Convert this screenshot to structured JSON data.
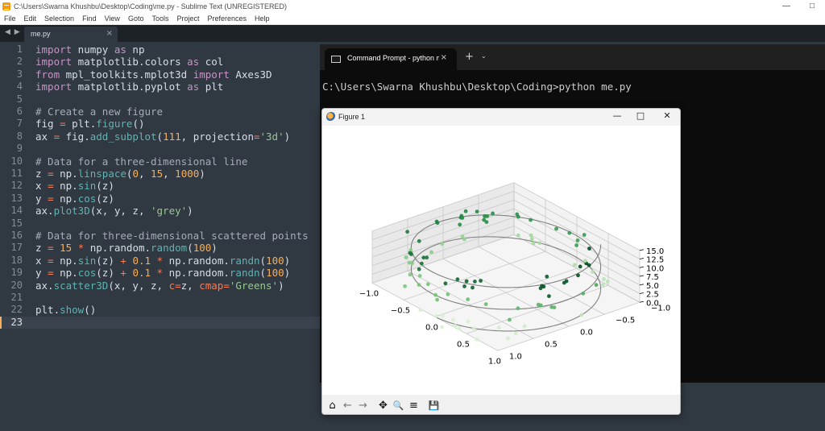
{
  "title_bar": {
    "text": "C:\\Users\\Swarna Khushbu\\Desktop\\Coding\\me.py - Sublime Text (UNREGISTERED)",
    "minimize": "—",
    "maximize": "□"
  },
  "menu": [
    "File",
    "Edit",
    "Selection",
    "Find",
    "View",
    "Goto",
    "Tools",
    "Project",
    "Preferences",
    "Help"
  ],
  "tabbar": {
    "nav_arrows": "◀ ▶",
    "tab_label": "me.py",
    "tab_close": "×"
  },
  "editor": {
    "active_line": 23,
    "line_numbers": [
      "1",
      "2",
      "3",
      "4",
      "5",
      "6",
      "7",
      "8",
      "9",
      "10",
      "11",
      "12",
      "13",
      "14",
      "15",
      "16",
      "17",
      "18",
      "19",
      "20",
      "21",
      "22",
      "23"
    ],
    "code": [
      [
        [
          "kw",
          "import"
        ],
        [
          "id",
          " numpy "
        ],
        [
          "kw",
          "as"
        ],
        [
          "id",
          " np"
        ]
      ],
      [
        [
          "kw",
          "import"
        ],
        [
          "id",
          " matplotlib.colors "
        ],
        [
          "kw",
          "as"
        ],
        [
          "id",
          " col"
        ]
      ],
      [
        [
          "kw",
          "from"
        ],
        [
          "id",
          " mpl_toolkits.mplot3d "
        ],
        [
          "kw",
          "import"
        ],
        [
          "id",
          " Axes3D"
        ]
      ],
      [
        [
          "kw",
          "import"
        ],
        [
          "id",
          " matplotlib.pyplot "
        ],
        [
          "kw",
          "as"
        ],
        [
          "id",
          " plt"
        ]
      ],
      [],
      [
        [
          "cm",
          "# Create a new figure"
        ]
      ],
      [
        [
          "id",
          "fig "
        ],
        [
          "op",
          "="
        ],
        [
          "id",
          " plt."
        ],
        [
          "fn",
          "figure"
        ],
        [
          "id",
          "()"
        ]
      ],
      [
        [
          "id",
          "ax "
        ],
        [
          "op",
          "="
        ],
        [
          "id",
          " fig."
        ],
        [
          "fn",
          "add_subplot"
        ],
        [
          "id",
          "("
        ],
        [
          "num",
          "111"
        ],
        [
          "id",
          ", projection"
        ],
        [
          "op",
          "="
        ],
        [
          "str",
          "'3d'"
        ],
        [
          "id",
          ")"
        ]
      ],
      [],
      [
        [
          "cm",
          "# Data for a three-dimensional line"
        ]
      ],
      [
        [
          "id",
          "z "
        ],
        [
          "op",
          "="
        ],
        [
          "id",
          " np."
        ],
        [
          "fn",
          "linspace"
        ],
        [
          "id",
          "("
        ],
        [
          "num",
          "0"
        ],
        [
          "id",
          ", "
        ],
        [
          "num",
          "15"
        ],
        [
          "id",
          ", "
        ],
        [
          "num",
          "1000"
        ],
        [
          "id",
          ")"
        ]
      ],
      [
        [
          "id",
          "x "
        ],
        [
          "op",
          "="
        ],
        [
          "id",
          " np."
        ],
        [
          "fn",
          "sin"
        ],
        [
          "id",
          "(z)"
        ]
      ],
      [
        [
          "id",
          "y "
        ],
        [
          "op",
          "="
        ],
        [
          "id",
          " np."
        ],
        [
          "fn",
          "cos"
        ],
        [
          "id",
          "(z)"
        ]
      ],
      [
        [
          "id",
          "ax."
        ],
        [
          "fn",
          "plot3D"
        ],
        [
          "id",
          "(x, y, z, "
        ],
        [
          "str",
          "'grey'"
        ],
        [
          "id",
          ")"
        ]
      ],
      [],
      [
        [
          "cm",
          "# Data for three-dimensional scattered points"
        ]
      ],
      [
        [
          "id",
          "z "
        ],
        [
          "op",
          "="
        ],
        [
          "num",
          " 15"
        ],
        [
          "op",
          " *"
        ],
        [
          "id",
          " np.random."
        ],
        [
          "fn",
          "random"
        ],
        [
          "id",
          "("
        ],
        [
          "num",
          "100"
        ],
        [
          "id",
          ")"
        ]
      ],
      [
        [
          "id",
          "x "
        ],
        [
          "op",
          "="
        ],
        [
          "id",
          " np."
        ],
        [
          "fn",
          "sin"
        ],
        [
          "id",
          "(z) "
        ],
        [
          "op",
          "+"
        ],
        [
          "num",
          " 0.1"
        ],
        [
          "op",
          " *"
        ],
        [
          "id",
          " np.random."
        ],
        [
          "fn",
          "randn"
        ],
        [
          "id",
          "("
        ],
        [
          "num",
          "100"
        ],
        [
          "id",
          ")"
        ]
      ],
      [
        [
          "id",
          "y "
        ],
        [
          "op",
          "="
        ],
        [
          "id",
          " np."
        ],
        [
          "fn",
          "cos"
        ],
        [
          "id",
          "(z) "
        ],
        [
          "op",
          "+"
        ],
        [
          "num",
          " 0.1"
        ],
        [
          "op",
          " *"
        ],
        [
          "id",
          " np.random."
        ],
        [
          "fn",
          "randn"
        ],
        [
          "id",
          "("
        ],
        [
          "num",
          "100"
        ],
        [
          "id",
          ")"
        ]
      ],
      [
        [
          "id",
          "ax."
        ],
        [
          "fn",
          "scatter3D"
        ],
        [
          "id",
          "(x, y, z, "
        ],
        [
          "op",
          "c="
        ],
        [
          "id",
          "z, "
        ],
        [
          "op",
          "cmap="
        ],
        [
          "str",
          "'Greens'"
        ],
        [
          "id",
          ")"
        ]
      ],
      [],
      [
        [
          "id",
          "plt."
        ],
        [
          "fn",
          "show"
        ],
        [
          "id",
          "()"
        ]
      ],
      []
    ]
  },
  "terminal": {
    "tab_label": "Command Prompt - python me.py",
    "tab_close": "×",
    "new_tab": "+",
    "dropdown": "⌄",
    "prompt_line": "C:\\Users\\Swarna Khushbu\\Desktop\\Coding>python me.py"
  },
  "figure_window": {
    "title": "Figure 1",
    "minimize": "—",
    "maximize": "□",
    "close": "✕",
    "toolbar": {
      "home": "⌂",
      "back": "←",
      "forward": "→",
      "pan": "✥",
      "zoom": "🔍",
      "configure": "≡",
      "save": "💾"
    }
  },
  "chart_data": {
    "type": "scatter3d",
    "z_ticks": [
      "0.0",
      "2.5",
      "5.0",
      "7.5",
      "10.0",
      "12.5",
      "15.0"
    ],
    "x_ticks": [
      "−1.0",
      "−0.5",
      "0.0",
      "0.5",
      "1.0"
    ],
    "y_ticks": [
      "−1.0",
      "−0.5",
      "0.0",
      "0.5",
      "1.0"
    ],
    "line": {
      "color": "grey",
      "z_range": [
        0,
        15
      ],
      "x": "sin(z)",
      "y": "cos(z)"
    },
    "scatter": {
      "cmap": "Greens",
      "count": 100,
      "z_range": [
        0,
        15
      ]
    },
    "xlim": [
      -1.0,
      1.0
    ],
    "ylim": [
      -1.0,
      1.0
    ],
    "zlim": [
      0.0,
      15.0
    ],
    "grid": true
  }
}
